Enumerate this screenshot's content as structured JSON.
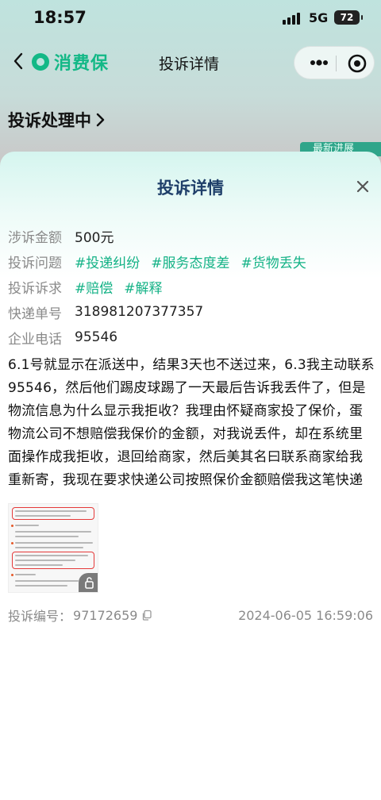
{
  "status_bar": {
    "time": "18:57",
    "network": "5G",
    "battery": "72"
  },
  "nav": {
    "brand": "消费保",
    "title": "投诉详情",
    "brand_color": "#13b886"
  },
  "background_page": {
    "heading": "投诉处理中",
    "latest_badge": "最新进展"
  },
  "sheet": {
    "title": "投诉详情",
    "fields": {
      "amount_label": "涉诉金额",
      "amount_value": "500元",
      "issue_label": "投诉问题",
      "issue_tags": [
        "#投递纠纷",
        "#服务态度差",
        "#货物丢失"
      ],
      "demand_label": "投诉诉求",
      "demand_tags": [
        "#赔偿",
        "#解释"
      ],
      "tracking_label": "快递单号",
      "tracking_value": "318981207377357",
      "phone_label": "企业电话",
      "phone_value": "95546"
    },
    "description": "6.1号就显示在派送中，结果3天也不送过来，6.3我主动联系95546，然后他们踢皮球踢了一天最后告诉我丢件了，但是物流信息为什么显示我拒收？我理由怀疑商家投了保价，蛋物流公司不想赔偿我保价的金额，对我说丢件，却在系统里面操作成我拒收，退回给商家，然后美其名曰联系商家给我重新寄，我现在要求快递公司按照保价金额赔偿我这笔快递",
    "footer": {
      "id_label": "投诉编号：",
      "id_value": "97172659",
      "timestamp": "2024-06-05 16:59:06"
    },
    "tag_color": "#14b286",
    "title_color": "#1f3f6a"
  }
}
